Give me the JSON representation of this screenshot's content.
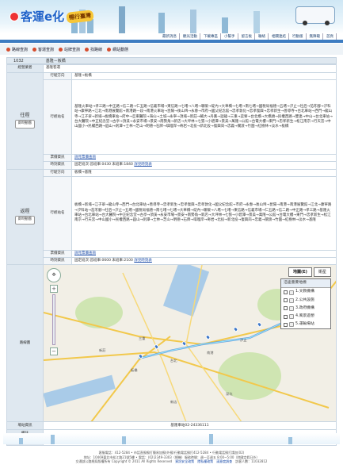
{
  "header": {
    "logo_text": "客運e化",
    "logo_tag": "暢行臺灣",
    "nav": [
      "最新消息",
      "觀光活動",
      "下載專區",
      "小幫手",
      "留言板",
      "聯絡",
      "相關連結",
      "行動版",
      "無障礙",
      "首頁"
    ]
  },
  "subtabs": [
    {
      "label": "路線查詢",
      "icon": "route-icon"
    },
    {
      "label": "客運查詢",
      "icon": "bus-icon"
    },
    {
      "label": "站牌查詢",
      "icon": "stop-icon"
    },
    {
      "label": "找路線",
      "icon": "search-icon"
    },
    {
      "label": "網站動態",
      "icon": "news-icon"
    }
  ],
  "route": {
    "number": "1032",
    "name": "基隆－板橋"
  },
  "operator": {
    "label": "經營業者",
    "value": "基隆客運"
  },
  "outbound": {
    "label": "往程",
    "button": "即時動態",
    "direction_label": "行駛方向",
    "direction": "基隆→板橋",
    "stops_label": "行經站名",
    "stops": "基隆火車站→孝三路→中正路→信二路→仁五路→信義市場→東信路→七堵→八堵→暖暖→碇內→大華橋→七堵→南七堵→國稅局福德→五堵→汐止→社后→茄苳腳→汐科站→康寧路→江北→南港展覽館→南港路一段→南港火車站→昆陽→後山埤→永春→市府→國父紀念館→忠孝敦化→忠孝復興→忠孝新生→善導寺→台北車站→西門→龍山寺→江子翠→新埔→板橋車站→府中→亞東醫院→海山→土城→永寧→頂埔→新莊→輔大→丹鳳→迴龍→三重→菜寮→台北橋→大橋頭→民權西路→雙連→中山→台北車站→台大醫院→中正紀念堂→古亭→頂溪→永安市場→景安→南勢角→新店→大坪林→七張→小碧潭→景美→萬隆→公館→台電大樓→東門→忠孝新生→松江南京→行天宮→中山國小→民權西路→圓山→劍潭→士林→芝山→明德→石牌→唭哩岸→奇岩→北投→新北投→復興崗→忠義→關渡→竹圍→紅樹林→淡水→板橋",
    "fare_label": "票價資訊",
    "fare_link": "詳見票價查詢",
    "time_label": "時刻資訊",
    "time_value": "固定班次:首班車:0430 末班車:1840",
    "time_link": "詳見時刻表"
  },
  "inbound": {
    "label": "返程",
    "button": "即時動態",
    "direction_label": "行駛方向",
    "direction": "板橋→基隆",
    "stops_label": "行經站名",
    "stops": "板橋→新埔→江子翠→龍山寺→西門→台北車站→善導寺→忠孝新生→忠孝復興→忠孝敦化→國父紀念館→市府→永春→後山埤→昆陽→南港→南港展覽館→江北→康寧路→汐科站→茄苳腳→社后→汐止→五堵→國稅局福德→南七堵→七堵→大華橋→碇內→暖暖→八堵→七堵→東信路→信義市場→仁五路→信二路→中正路→孝三路→基隆火車站→台北車站→台大醫院→中正紀念堂→古亭→頂溪→永安市場→景安→南勢角→新店→大坪林→七張→小碧潭→景美→萬隆→公館→台電大樓→東門→忠孝新生→松江南京→行天宮→中山國小→民權西路→圓山→劍潭→士林→芝山→明德→石牌→唭哩岸→奇岩→北投→新北投→復興崗→忠義→關渡→竹圍→紅樹林→淡水→基隆",
    "fare_label": "票價資訊",
    "fare_link": "詳見票價查詢",
    "time_label": "時刻資訊",
    "time_value": "固定班次:首班車:0600 末班車:2100",
    "time_link": "詳見時刻表"
  },
  "map": {
    "label": "路線圖",
    "types": [
      "地圖(E)",
      "衛星"
    ],
    "legend_title": "沿途重要地標",
    "legend_items": [
      "1.文教機構",
      "2.公共設施",
      "3.政府機構",
      "4.風景遊憩",
      "5.運輸場站"
    ],
    "places": [
      "基隆",
      "汐止",
      "南港",
      "台北",
      "板橋",
      "新店",
      "深坑",
      "三重",
      "新莊"
    ]
  },
  "contact": {
    "label": "場站資訊",
    "value": "基隆車站02-24336111"
  },
  "note": {
    "label": "備註",
    "value": ""
  },
  "apply": {
    "label": "申訴電話",
    "value": "臺北區監理所"
  },
  "footer": {
    "line1": "客服電話：412-5284 • 市話直撥撥打簡易加撥(外撥)行動電話撥打412-5284 • 行動電話撥打請加(02)",
    "line2": "地址：10469臺北市松江路21號5樓 • 電話：(02)2349-3303（總機）服務時間：週一至週五 8:00~5:00（除國定假日外）",
    "line3": "交通部公路總局版權所有 Copyright © 2011 All Rights Reserved",
    "links": [
      "資訊安全政策",
      "隱私權政策",
      "滿意度調查"
    ],
    "visits": "訪客人數：11032812"
  }
}
